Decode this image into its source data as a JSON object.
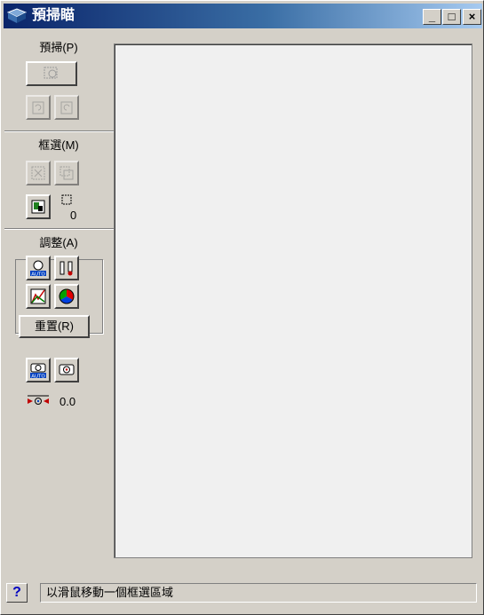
{
  "window": {
    "title": "預掃瞄",
    "minimize_label": "_",
    "maximize_label": "□",
    "close_label": "×"
  },
  "prescan": {
    "label": "預掃(P)"
  },
  "marquee": {
    "label": "框選(M)",
    "count": "0"
  },
  "adjust": {
    "label": "調整(A)",
    "reset_label": "重置(R)"
  },
  "exposure": {
    "value": "0.0"
  },
  "status": {
    "help_label": "?",
    "message": "以滑鼠移動一個框選區域"
  },
  "colors": {
    "title_start": "#0a246a",
    "title_end": "#a6caf0",
    "face": "#d4d0c8",
    "preview_bg": "#f0f0f0"
  }
}
